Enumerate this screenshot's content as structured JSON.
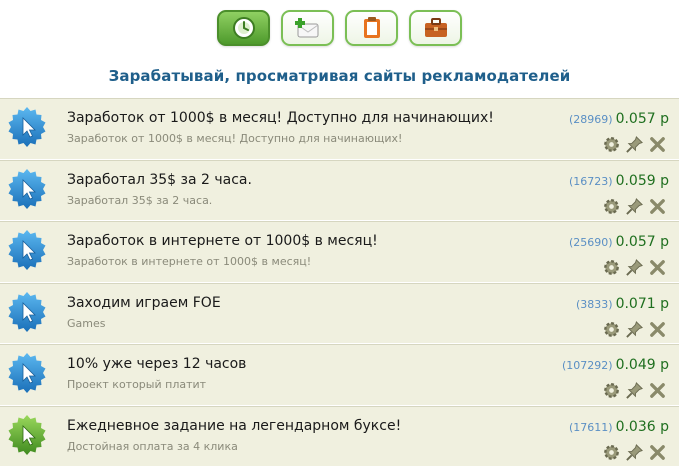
{
  "header": {
    "title": "Зарабатывай, просматривая сайты рекламодателей",
    "buttons": [
      {
        "icon": "clock-mouse-icon",
        "active": true
      },
      {
        "icon": "add-mail-icon",
        "active": false
      },
      {
        "icon": "clipboard-icon",
        "active": false
      },
      {
        "icon": "briefcase-icon",
        "active": false
      }
    ]
  },
  "colors": {
    "accent_green": "#5aa837",
    "badge_blue": "#2a8fd6",
    "title_blue": "#1f5f8b",
    "row_bg": "#f0f0df"
  },
  "rows": [
    {
      "title": "Заработок от 1000$ в месяц! Доступно для начинающих!",
      "subtitle": "Заработок от 1000$ в месяц! Доступно для начинающих!",
      "count": "(28969)",
      "price": "0.057 р",
      "badge": "blue"
    },
    {
      "title": "Заработал 35$ за 2 часа.",
      "subtitle": "Заработал 35$ за 2 часа.",
      "count": "(16723)",
      "price": "0.059 р",
      "badge": "blue"
    },
    {
      "title": "Заработок в интернете от 1000$ в месяц!",
      "subtitle": "Заработок в интернете от 1000$ в месяц!",
      "count": "(25690)",
      "price": "0.057 р",
      "badge": "blue"
    },
    {
      "title": "Заходим играем FOE",
      "subtitle": "Games",
      "count": "(3833)",
      "price": "0.071 р",
      "badge": "blue"
    },
    {
      "title": "10% уже через 12 часов",
      "subtitle": "Проект который платит",
      "count": "(107292)",
      "price": "0.049 р",
      "badge": "blue"
    },
    {
      "title": "Ежедневное задание на легендарном буксе!",
      "subtitle": "Достойная оплата за 4 клика",
      "count": "(17611)",
      "price": "0.036 р",
      "badge": "green"
    }
  ]
}
